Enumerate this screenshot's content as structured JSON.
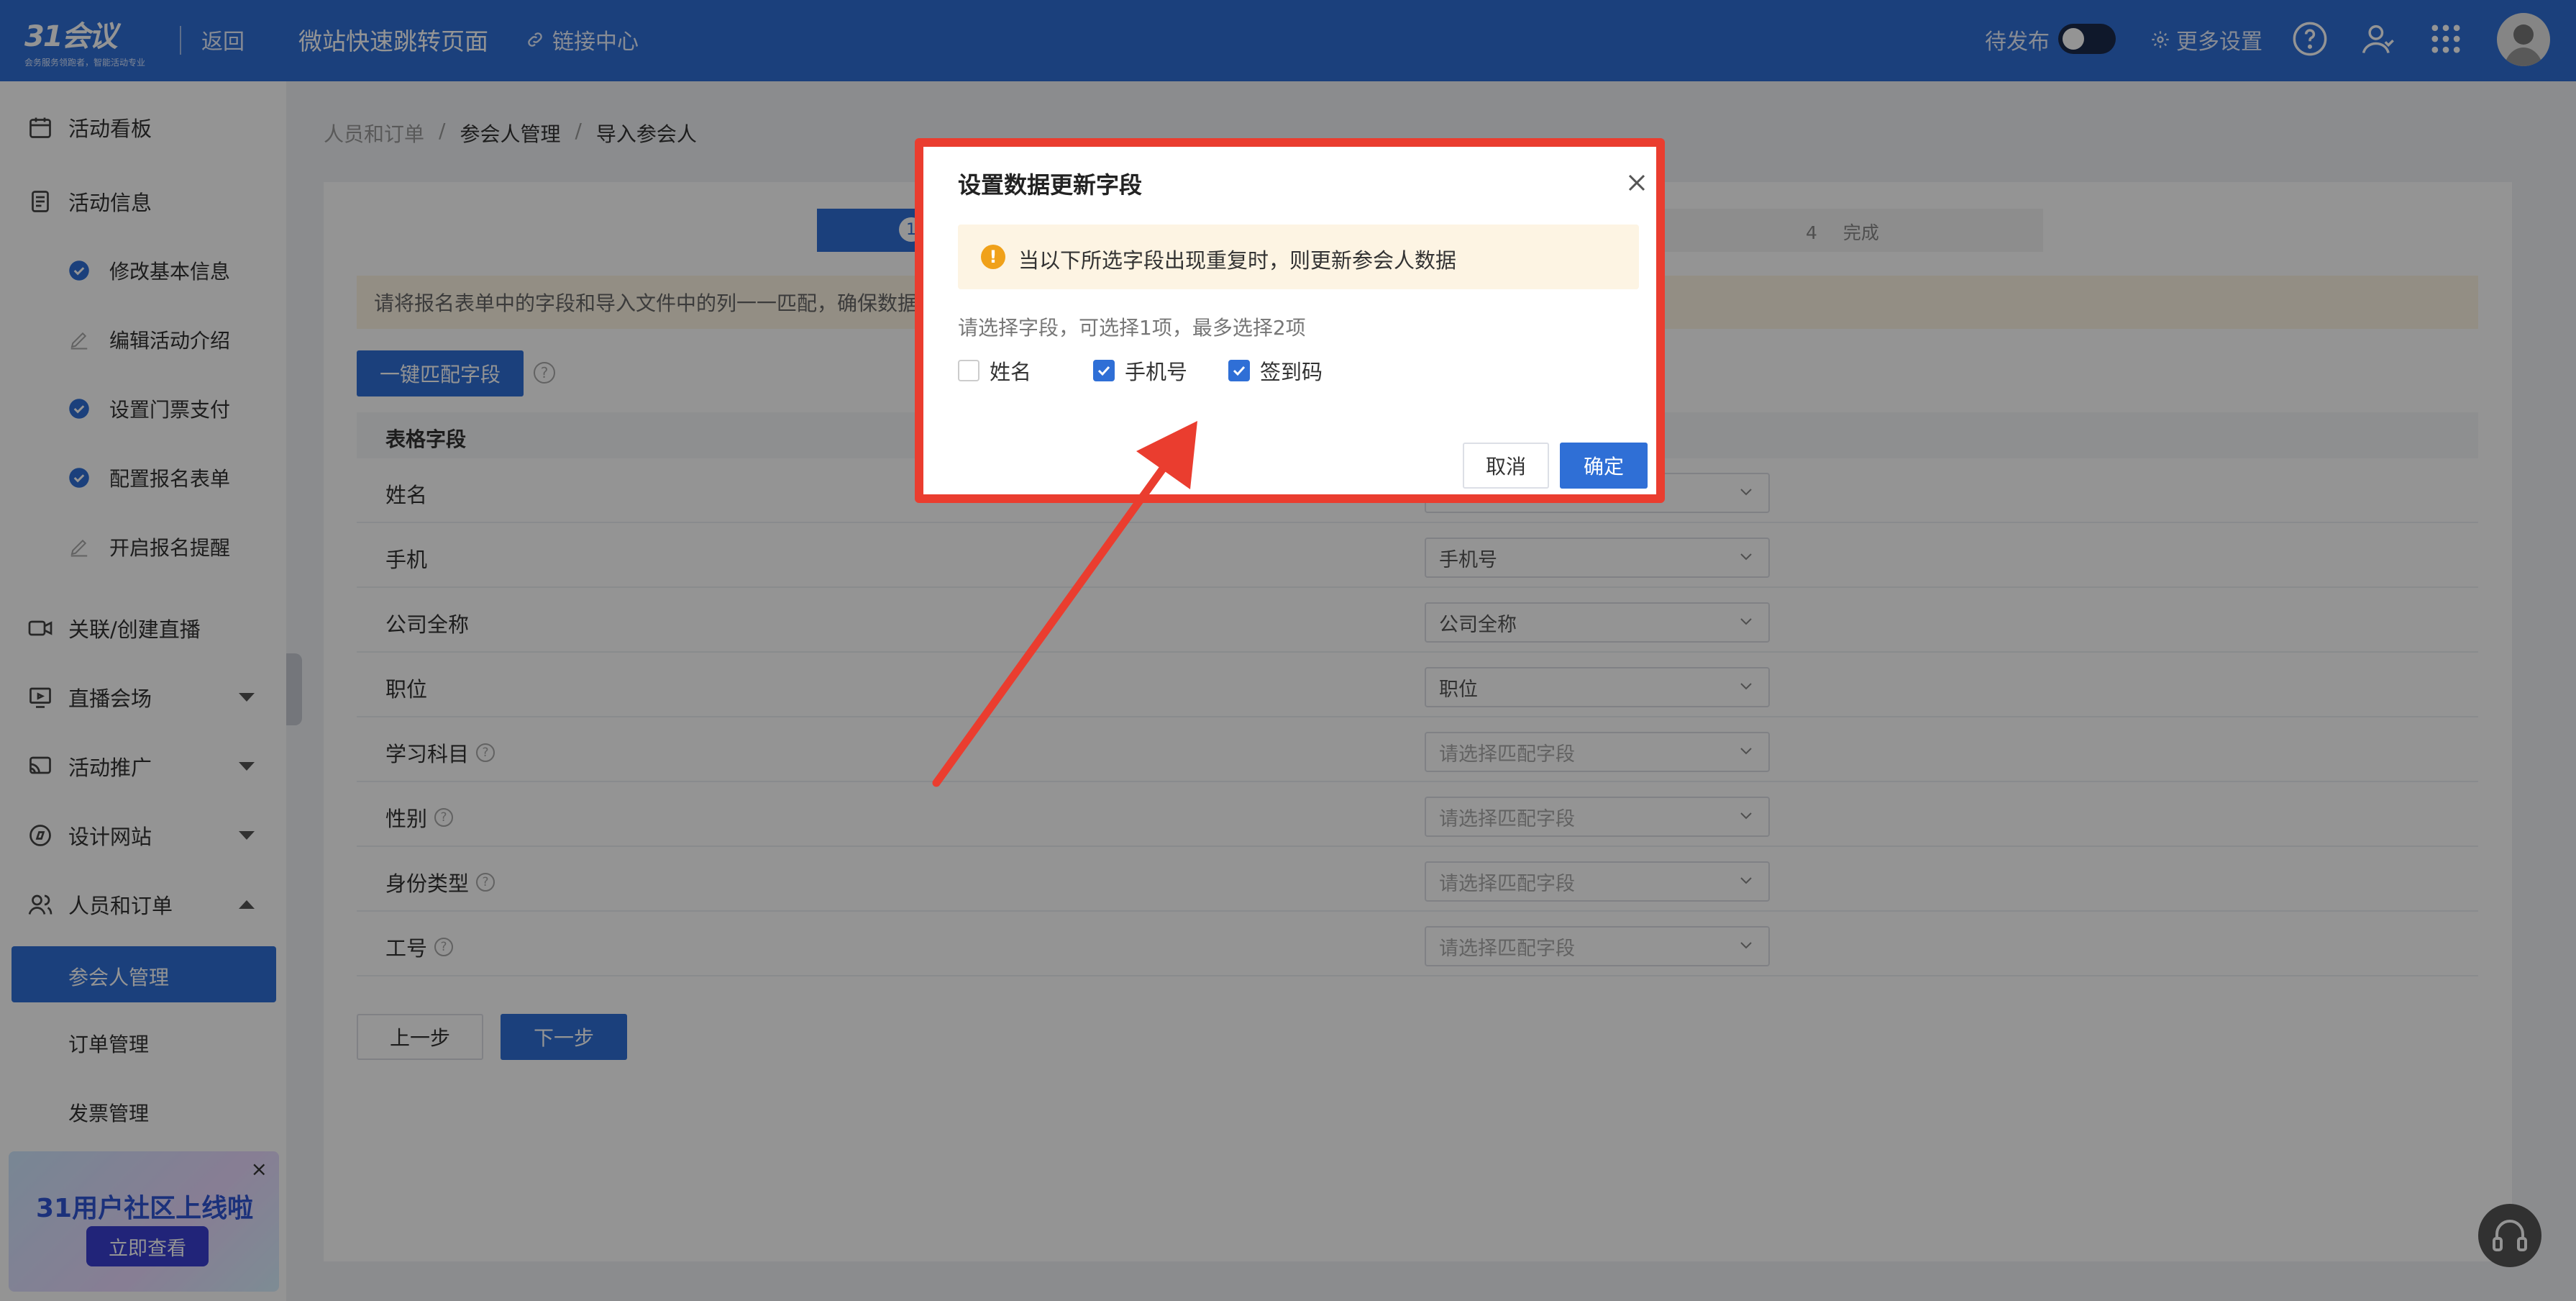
{
  "topbar": {
    "logo_text": "31会议",
    "logo_sub": "会务服务领跑者，智能活动专业",
    "back": "返回",
    "title": "微站快速跳转页面",
    "link_center": "链接中心",
    "status": "待发布",
    "more_settings": "更多设置"
  },
  "sidebar": {
    "items": [
      {
        "label": "活动看板"
      },
      {
        "label": "活动信息"
      },
      {
        "label": "修改基本信息"
      },
      {
        "label": "编辑活动介绍"
      },
      {
        "label": "设置门票支付"
      },
      {
        "label": "配置报名表单"
      },
      {
        "label": "开启报名提醒"
      },
      {
        "label": "关联/创建直播"
      },
      {
        "label": "直播会场"
      },
      {
        "label": "活动推广"
      },
      {
        "label": "设计网站"
      },
      {
        "label": "人员和订单"
      },
      {
        "label": "参会人管理"
      },
      {
        "label": "订单管理"
      },
      {
        "label": "发票管理"
      }
    ],
    "banner": {
      "title": "31用户社区上线啦",
      "button": "立即查看",
      "close": "×"
    }
  },
  "breadcrumb": [
    "人员和订单",
    "参会人管理",
    "导入参会人"
  ],
  "steps": {
    "active_number": "1",
    "last_number": "4",
    "last_label": "完成"
  },
  "main": {
    "hint": "请将报名表单中的字段和导入文件中的列一一匹配，确保数据",
    "auto_match": "一键匹配字段",
    "table_header": "表格字段",
    "rows": [
      {
        "field": "姓名",
        "value": "",
        "help": false
      },
      {
        "field": "手机",
        "value": "手机号",
        "help": false
      },
      {
        "field": "公司全称",
        "value": "公司全称",
        "help": false
      },
      {
        "field": "职位",
        "value": "职位",
        "help": false
      },
      {
        "field": "学习科目",
        "value": "请选择匹配字段",
        "help": true
      },
      {
        "field": "性别",
        "value": "请选择匹配字段",
        "help": true
      },
      {
        "field": "身份类型",
        "value": "请选择匹配字段",
        "help": true
      },
      {
        "field": "工号",
        "value": "请选择匹配字段",
        "help": true
      }
    ],
    "prev": "上一步",
    "next": "下一步"
  },
  "modal": {
    "title": "设置数据更新字段",
    "warning": "当以下所选字段出现重复时，则更新参会人数据",
    "hint": "请选择字段，可选择1项，最多选择2项",
    "options": [
      {
        "label": "姓名",
        "checked": false
      },
      {
        "label": "手机号",
        "checked": true
      },
      {
        "label": "签到码",
        "checked": true
      }
    ],
    "cancel": "取消",
    "confirm": "确定"
  },
  "colors": {
    "primary": "#2f6fd6",
    "annotation": "#ea3d2f",
    "warning": "#f0a11a"
  }
}
